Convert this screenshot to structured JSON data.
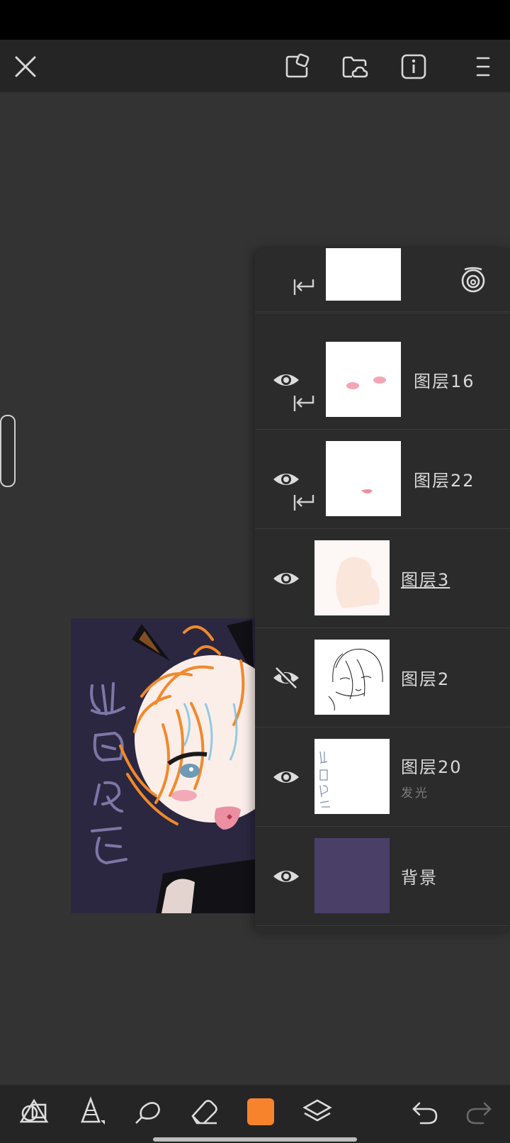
{
  "app": {
    "accent_color": "#f7832c",
    "background_color": "#333333"
  },
  "topbar": {
    "icons": [
      "close-icon",
      "import-icon",
      "cloud-folder-icon",
      "info-icon",
      "menu-icon"
    ]
  },
  "layers_panel": {
    "add_icon": "plus-icon",
    "settings_icon": "layer-settings-icon",
    "layers": [
      {
        "name": "",
        "visible": true,
        "clipping": true,
        "thumb_color": "#ffffff"
      },
      {
        "name": "图层16",
        "visible": true,
        "clipping": true,
        "thumb_color": "#ffffff"
      },
      {
        "name": "图层22",
        "visible": true,
        "clipping": true,
        "thumb_color": "#ffffff"
      },
      {
        "name": "图层3",
        "visible": true,
        "clipping": false,
        "active": true,
        "thumb_color": "#fbf3ef"
      },
      {
        "name": "图层2",
        "visible": false,
        "clipping": false,
        "thumb_color": "#ffffff"
      },
      {
        "name": "图层20",
        "sub": "发光",
        "visible": true,
        "clipping": false,
        "thumb_color": "#ffffff"
      },
      {
        "name": "背景",
        "visible": true,
        "clipping": false,
        "thumb_color": "#4a3f67"
      }
    ]
  },
  "toolbar": {
    "tools": [
      "shapes-icon",
      "brush-icon",
      "smudge-icon",
      "eraser-icon",
      "color-swatch",
      "layers-icon",
      "undo-icon",
      "redo-icon"
    ],
    "current_color": "#f7832c"
  }
}
